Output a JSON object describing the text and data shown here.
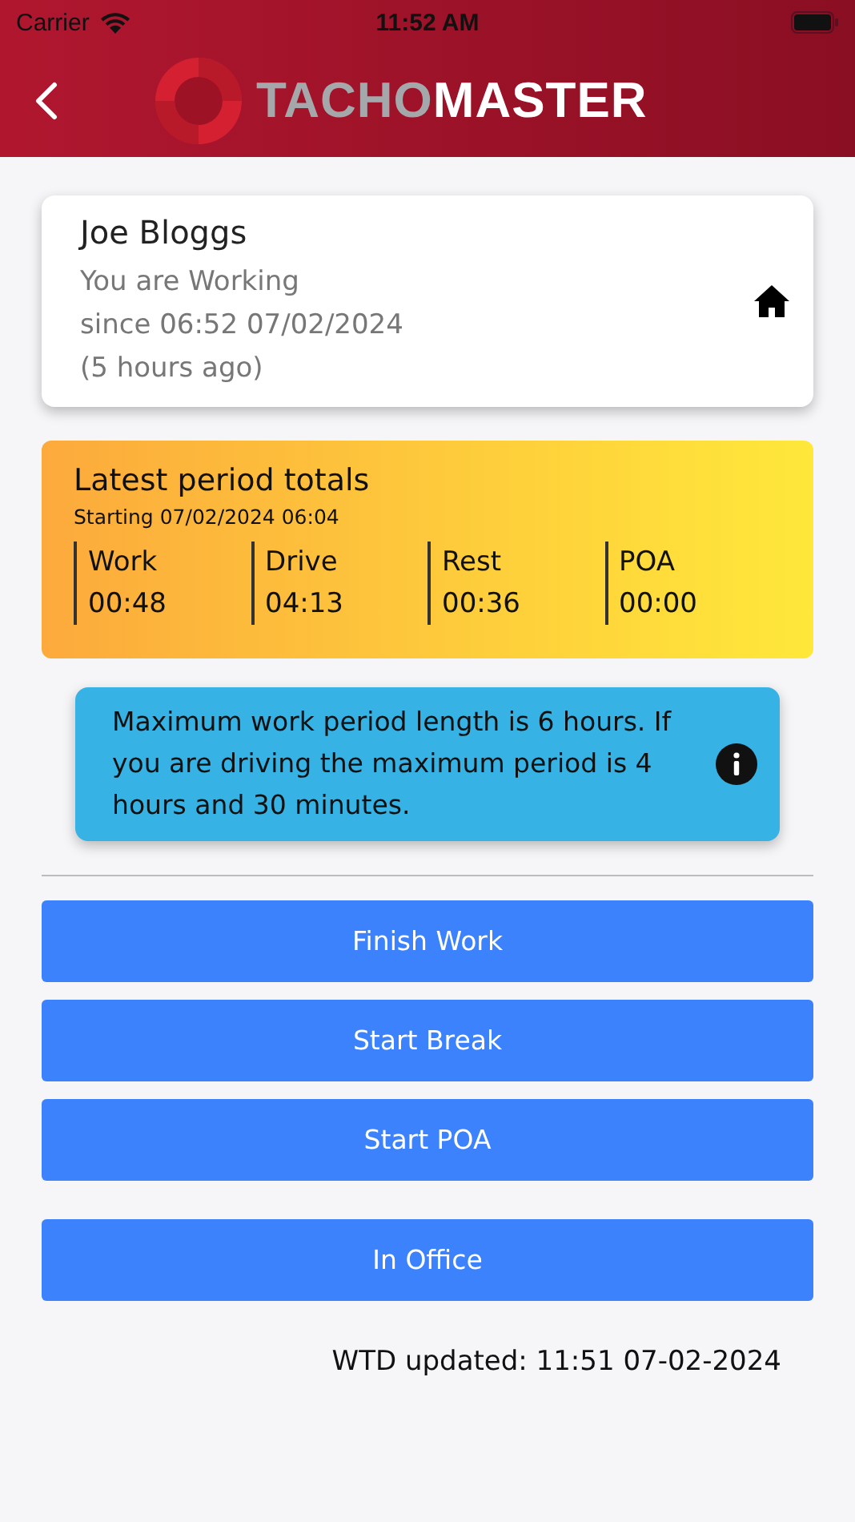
{
  "status_bar": {
    "carrier": "Carrier",
    "time": "11:52 AM"
  },
  "header": {
    "logo_left": "TACHO",
    "logo_right": "MASTER"
  },
  "driver_card": {
    "name": "Joe Bloggs",
    "status_lines": [
      "You are Working",
      "since 06:52 07/02/2024",
      "(5 hours ago)"
    ]
  },
  "totals": {
    "title": "Latest period totals",
    "subtitle": "Starting 07/02/2024 06:04",
    "items": [
      {
        "label": "Work",
        "value": "00:48"
      },
      {
        "label": "Drive",
        "value": "04:13"
      },
      {
        "label": "Rest",
        "value": "00:36"
      },
      {
        "label": "POA",
        "value": "00:00"
      }
    ]
  },
  "info": {
    "text": "Maximum work period length is 6 hours. If you are driving the maximum period is 4 hours and 30 minutes."
  },
  "actions": [
    {
      "label": "Finish Work",
      "kind": "primary"
    },
    {
      "label": "Start Break",
      "kind": "primary"
    },
    {
      "label": "Start POA",
      "kind": "primary"
    },
    {
      "label": "In Office",
      "kind": "separate"
    }
  ],
  "footer": {
    "wtd": "WTD updated: 11:51 07-02-2024"
  }
}
